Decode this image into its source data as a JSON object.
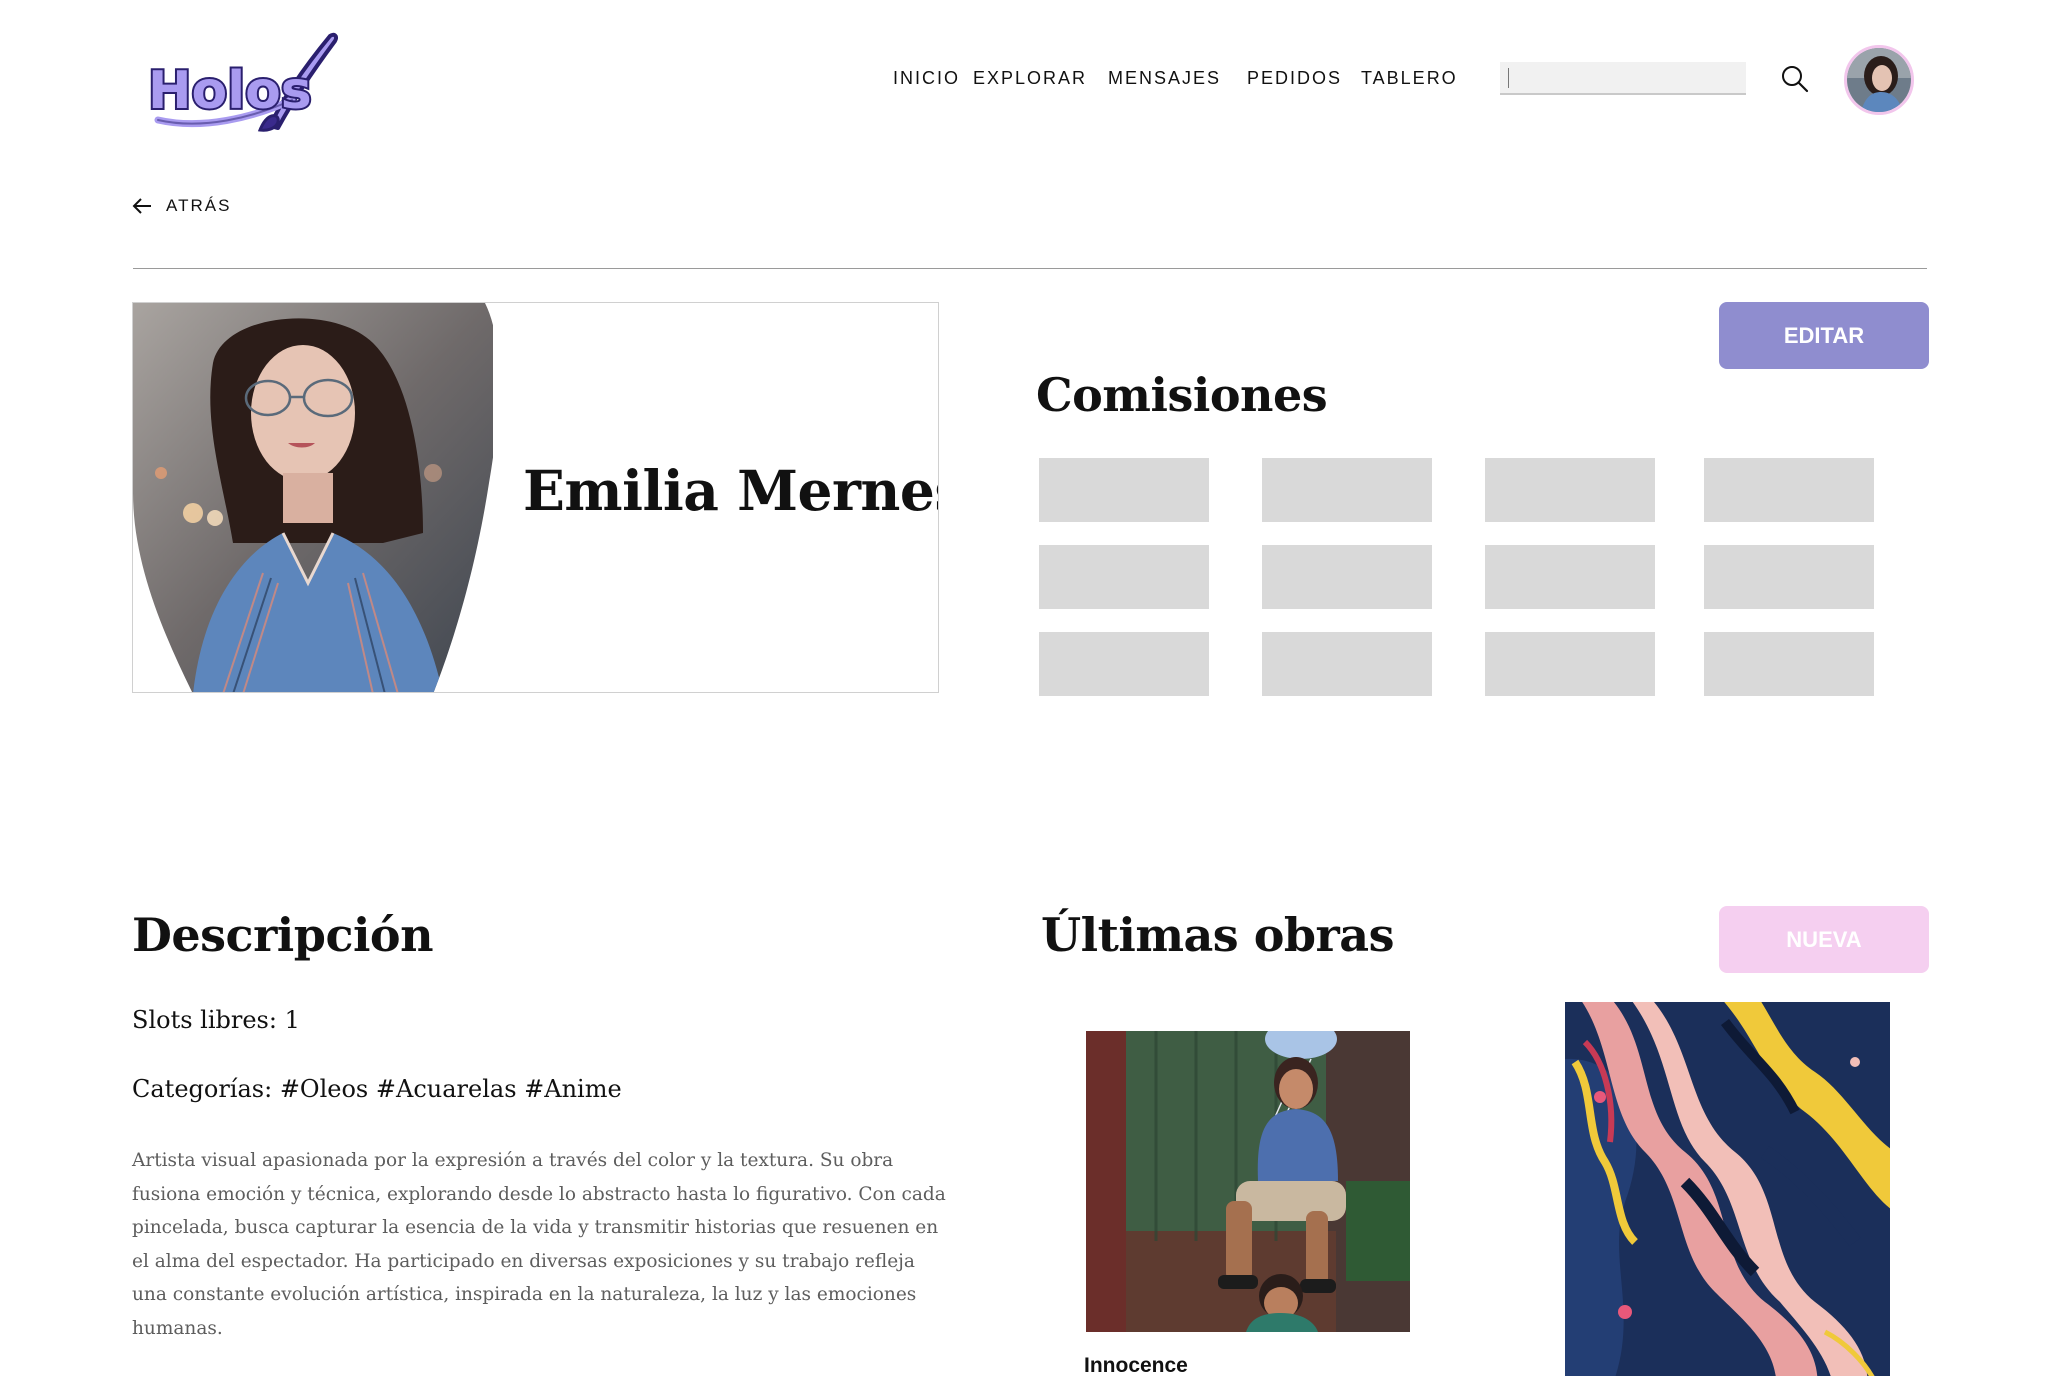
{
  "header": {
    "logo_text": "Holos",
    "nav": [
      "INICIO",
      "EXPLORAR",
      "MENSAJES",
      "PEDIDOS",
      "TABLERO"
    ],
    "search": {
      "value": "",
      "placeholder": ""
    }
  },
  "back": {
    "label": "ATRÁS"
  },
  "profile": {
    "name": "Emilia Mernes",
    "edit_label": "EDITAR"
  },
  "commissions": {
    "title": "Comisiones",
    "slots": [
      {
        "row": 1,
        "col": 1
      },
      {
        "row": 1,
        "col": 2
      },
      {
        "row": 1,
        "col": 3
      },
      {
        "row": 1,
        "col": 4
      },
      {
        "row": 2,
        "col": 1
      },
      {
        "row": 2,
        "col": 2
      },
      {
        "row": 2,
        "col": 3
      },
      {
        "row": 2,
        "col": 4
      },
      {
        "row": 3,
        "col": 1
      },
      {
        "row": 3,
        "col": 2
      },
      {
        "row": 3,
        "col": 3
      },
      {
        "row": 3,
        "col": 4
      }
    ]
  },
  "description": {
    "title": "Descripción",
    "slots": "Slots libres: 1",
    "categories": "Categorías: #Oleos #Acuarelas #Anime",
    "body": "Artista visual apasionada por la expresión a través del color y la textura. Su obra fusiona emoción y técnica, explorando desde lo abstracto hasta lo figurativo. Con cada pincelada, busca capturar la esencia de la vida y transmitir historias que resuenen en el alma del espectador. Ha participado en diversas exposiciones y su trabajo refleja una constante evolución artística, inspirada en la naturaleza, la luz y las emociones humanas."
  },
  "works": {
    "title": "Últimas obras",
    "new_label": "NUEVA",
    "items": [
      {
        "title": "Innocence"
      },
      {
        "title": ""
      }
    ]
  },
  "colors": {
    "edit_button": "#8f8dcf",
    "new_button": "#f5cff0",
    "placeholder": "#d9d9d9",
    "logo_fill": "#3a2a8c",
    "logo_accent": "#a99bf0"
  }
}
